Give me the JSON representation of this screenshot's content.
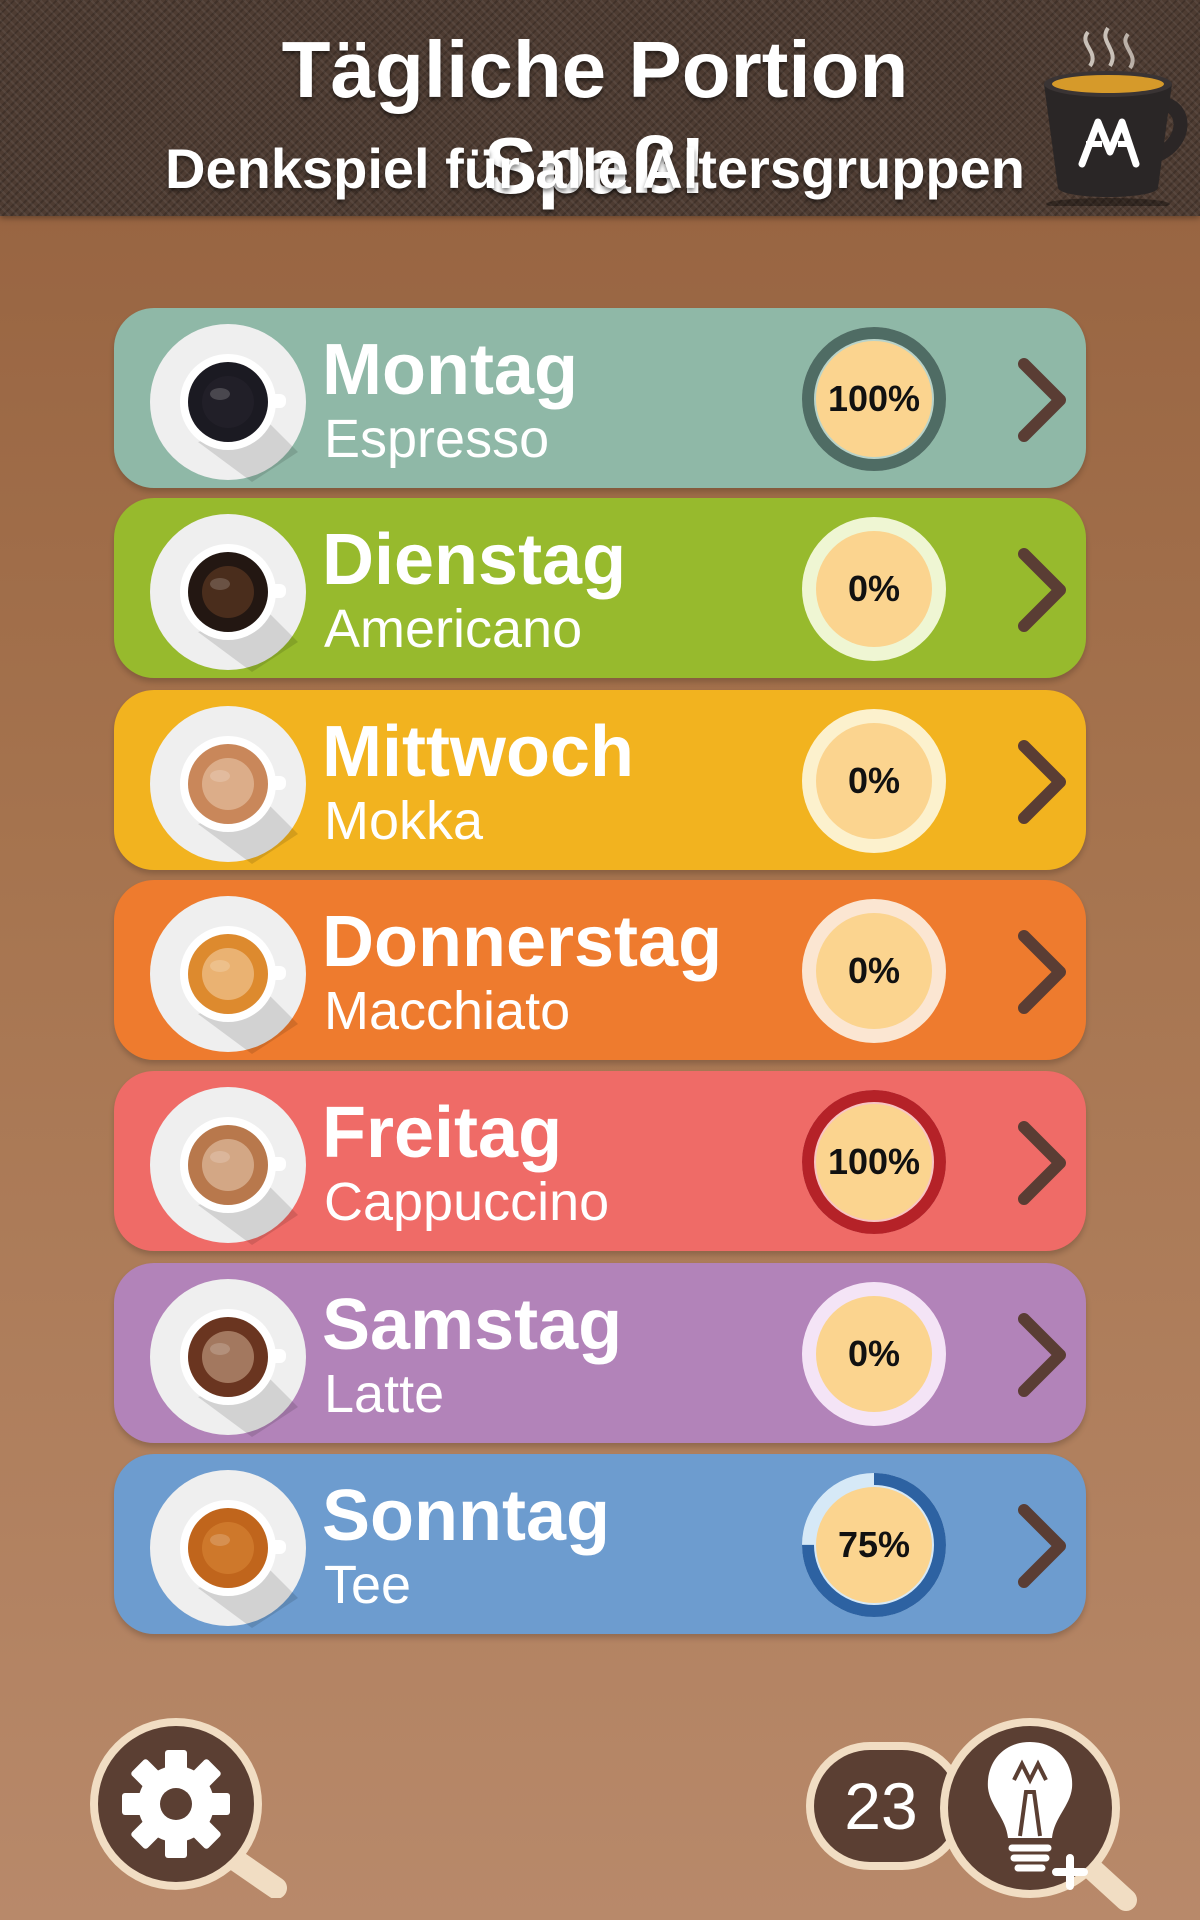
{
  "header": {
    "title": "Tägliche Portion Spaß!",
    "subtitle": "Denkspiel für alle Altersgruppen"
  },
  "days": [
    {
      "day": "Montag",
      "drink": "Espresso",
      "progress_label": "100%",
      "progress": 1.0,
      "color": "#8fb8a7",
      "ring_track": "#b9d3c9",
      "ring_fill": "#4f6c64",
      "coffee": "#1b1a22",
      "crema": "#2b2630"
    },
    {
      "day": "Dienstag",
      "drink": "Americano",
      "progress_label": "0%",
      "progress": 0.0,
      "color": "#97ba2d",
      "ring_track": "#eff6d3",
      "ring_fill": "#5d7a1b",
      "coffee": "#231712",
      "crema": "#7a4a2b"
    },
    {
      "day": "Mittwoch",
      "drink": "Mokka",
      "progress_label": "0%",
      "progress": 0.0,
      "color": "#f2b31f",
      "ring_track": "#fcf1cd",
      "ring_fill": "#a8780a",
      "coffee": "#c9875a",
      "crema": "#f3dcc4"
    },
    {
      "day": "Donnerstag",
      "drink": "Macchiato",
      "progress_label": "0%",
      "progress": 0.0,
      "color": "#ee7b2e",
      "ring_track": "#fbe6d2",
      "ring_fill": "#a4501a",
      "coffee": "#dd8a2e",
      "crema": "#fbe2c6"
    },
    {
      "day": "Freitag",
      "drink": "Cappuccino",
      "progress_label": "100%",
      "progress": 1.0,
      "color": "#ef6b67",
      "ring_track": "#f8c5c3",
      "ring_fill": "#b52228",
      "coffee": "#b8784c",
      "crema": "#f4e0cc"
    },
    {
      "day": "Samstag",
      "drink": "Latte",
      "progress_label": "0%",
      "progress": 0.0,
      "color": "#b283b9",
      "ring_track": "#f4e4f6",
      "ring_fill": "#7c4f83",
      "coffee": "#6a3520",
      "crema": "#e8c9ae"
    },
    {
      "day": "Sonntag",
      "drink": "Tee",
      "progress_label": "75%",
      "progress": 0.75,
      "color": "#6d9ccf",
      "ring_track": "#d6e9f7",
      "ring_fill": "#2d62a2",
      "coffee": "#c0651c",
      "crema": "#e0903d"
    }
  ],
  "hints": {
    "count": "23"
  },
  "icons": {
    "settings": "gear-icon",
    "hint": "lightbulb-plus-icon",
    "row_arrow": "chevron-right-icon",
    "logo": "coffee-cup-logo-icon"
  }
}
